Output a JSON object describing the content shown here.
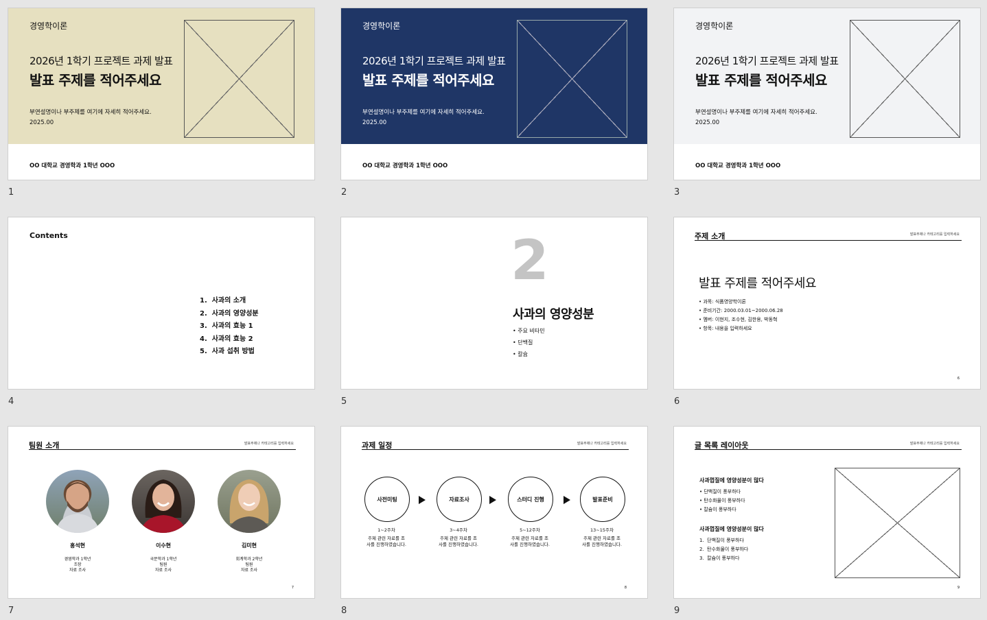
{
  "colors": {
    "beige": "#e6e0c0",
    "navy": "#1f3666",
    "lightgray": "#f2f3f5",
    "gray2": "#c4c4c4"
  },
  "slide_numbers": [
    "1",
    "2",
    "3",
    "4",
    "5",
    "6",
    "7",
    "8",
    "9"
  ],
  "cover": {
    "course": "경영학이론",
    "subtitle": "2026년 1학기 프로젝트 과제 발표",
    "title": "발표 주제를 적어주세요",
    "desc": "부연설명이나 부주제를 여기에 자세히 적어주세요.",
    "date": "2025.00",
    "footer": "OO 대학교 경영학과 1학년 OOO"
  },
  "contents": {
    "title": "Contents",
    "items": [
      "1.  사과의 소개",
      "2.  사과의 영양성분",
      "3.  사과의 효능 1",
      "4.  사과의 효능 2",
      "5.  사과 섭취 방법"
    ]
  },
  "section": {
    "number": "2",
    "title": "사과의 영양성분",
    "bullets": [
      "주요 비타민",
      "단백질",
      "칼슘"
    ]
  },
  "header_sub": "발표주제나 카테고리를 입력하세요",
  "topic": {
    "header": "주제 소개",
    "title": "발표 주제를 적어주세요",
    "bullets": [
      "과목: 식품영양학이론",
      "준비기간: 2000.03.01~2000.06.28",
      "멤버: 이현지, 조수현, 김한용, 박동혁",
      "항목: 내용을 입력하세요"
    ],
    "page": "6"
  },
  "team": {
    "header": "팀원 소개",
    "page": "7",
    "members": [
      {
        "name": "홍석현",
        "line1": "경영학과 1학년",
        "line2": "조장",
        "line3": "자료 조사"
      },
      {
        "name": "이수현",
        "line1": "국문학과 1학년",
        "line2": "팀원",
        "line3": "자료 조사"
      },
      {
        "name": "김미현",
        "line1": "회계학과 2학년",
        "line2": "팀원",
        "line3": "자료 조사"
      }
    ]
  },
  "schedule": {
    "header": "과제 일정",
    "page": "8",
    "steps": [
      {
        "label": "사전미팅",
        "weeks": "1~2주차",
        "desc1": "주제 관련 자료를 조",
        "desc2": "사를 진행하였습니다."
      },
      {
        "label": "자료조사",
        "weeks": "3~4주차",
        "desc1": "주제 관련 자료를 조",
        "desc2": "사를 진행하였습니다."
      },
      {
        "label": "스터디 진행",
        "weeks": "5~12주차",
        "desc1": "주제 관련 자료를 조",
        "desc2": "사를 진행하였습니다."
      },
      {
        "label": "발표준비",
        "weeks": "13~15주차",
        "desc1": "주제 관련 자료를 조",
        "desc2": "사를 진행하였습니다."
      }
    ]
  },
  "textlist": {
    "header": "글 목록 레이아웃",
    "page": "9",
    "heading1": "사과껍질에 영양성분이 많다",
    "bullets": [
      "단백질이 풍부하다",
      "탄수화물이 풍부하다",
      "칼슘이 풍부하다"
    ],
    "heading2": "사과껍질에 영양성분이 많다",
    "numbered": [
      "1.  단백질이 풍부하다",
      "2.  탄수화물이 풍부하다",
      "3.  칼슘이 풍부하다"
    ]
  }
}
